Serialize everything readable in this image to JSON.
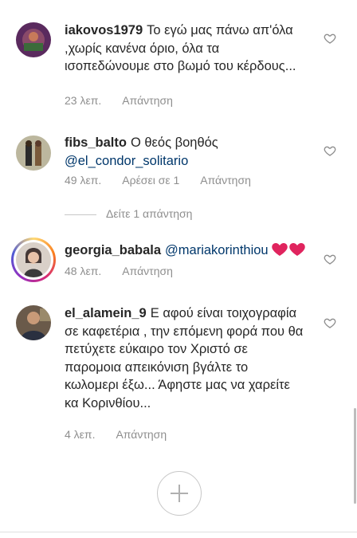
{
  "comments": [
    {
      "username": "iakovos1979",
      "text": "Το εγώ μας πάνω απ'όλα ,χωρίς κανένα όριο, όλα τα ισοπεδώνουμε στο βωμό του κέρδους...",
      "time": "23 λεπ.",
      "reply": "Απάντηση"
    },
    {
      "username": "fibs_balto",
      "text": "Ο θεός βοηθός",
      "mention": "@el_condor_solitario",
      "time": "49 λεπ.",
      "likes": "Αρέσει σε 1",
      "reply": "Απάντηση"
    },
    {
      "username": "georgia_babala",
      "mention": "@mariakorinthiou",
      "time": "48 λεπ.",
      "reply": "Απάντηση"
    },
    {
      "username": "el_alamein_9",
      "text": "Ε αφού είναι τοιχογραφία σε καφετέρια , την επόμενη φορά που θα πετύχετε εύκαιρο τον Χριστό σε παρομοια απεικόνιση βγάλτε το κωλομερι έξω... Άφηστε μας να χαρείτε κα Κορινθίου...",
      "time": "4 λεπ.",
      "reply": "Απάντηση"
    }
  ],
  "view_replies": "Δείτε 1 απάντηση",
  "icons": {
    "heart": "heart-outline-icon",
    "add": "plus-icon",
    "emoji": "red-heart-emoji"
  },
  "colors": {
    "text": "#262626",
    "meta": "#8e8e8e",
    "mention": "#00376b",
    "emoji_heart": "#e0245e"
  }
}
